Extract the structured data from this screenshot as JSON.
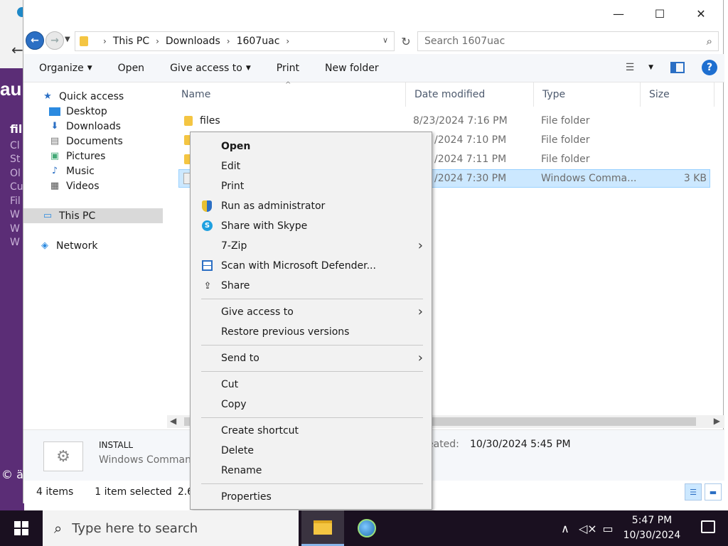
{
  "background_app": {
    "heading_fragment": "au",
    "lines_title": "fil",
    "lines": [
      "Cl",
      "St",
      "Ol",
      "Cu",
      "Fil",
      "W",
      "W",
      "W"
    ],
    "footer_fragment": "© ä"
  },
  "window": {
    "minimize": "—",
    "maximize": "☐",
    "close": "✕"
  },
  "address": {
    "crumbs": [
      "This PC",
      "Downloads",
      "1607uac"
    ],
    "search_placeholder": "Search 1607uac"
  },
  "toolbar": {
    "organize": "Organize",
    "open": "Open",
    "give_access": "Give access to",
    "print": "Print",
    "new_folder": "New folder",
    "help": "?"
  },
  "nav": {
    "quick_access": "Quick access",
    "desktop": "Desktop",
    "downloads": "Downloads",
    "documents": "Documents",
    "pictures": "Pictures",
    "music": "Music",
    "videos": "Videos",
    "this_pc": "This PC",
    "network": "Network"
  },
  "columns": {
    "name": "Name",
    "date": "Date modified",
    "type": "Type",
    "size": "Size"
  },
  "files": [
    {
      "name": "files",
      "date": "8/23/2024 7:16 PM",
      "type": "File folder",
      "size": ""
    },
    {
      "name": "",
      "date": "/2024 7:10 PM",
      "type": "File folder",
      "size": ""
    },
    {
      "name": "",
      "date": "/2024 7:11 PM",
      "type": "File folder",
      "size": ""
    },
    {
      "name": "",
      "date": "/2024 7:30 PM",
      "type": "Windows Comma...",
      "size": "3 KB"
    }
  ],
  "details": {
    "name": "INSTALL",
    "type": "Windows Command",
    "created_label": "eated:",
    "created_value": "10/30/2024 5:45 PM"
  },
  "status": {
    "count": "4 items",
    "selected": "1 item selected",
    "size": "2.61 K"
  },
  "context_menu": {
    "open": "Open",
    "edit": "Edit",
    "print": "Print",
    "run_as_admin": "Run as administrator",
    "share_skype": "Share with Skype",
    "seven_zip": "7-Zip",
    "scan_defender": "Scan with Microsoft Defender...",
    "share": "Share",
    "give_access": "Give access to",
    "restore_versions": "Restore previous versions",
    "send_to": "Send to",
    "cut": "Cut",
    "copy": "Copy",
    "create_shortcut": "Create shortcut",
    "delete": "Delete",
    "rename": "Rename",
    "properties": "Properties"
  },
  "taskbar": {
    "search_placeholder": "Type here to search",
    "time": "5:47 PM",
    "date": "10/30/2024"
  }
}
